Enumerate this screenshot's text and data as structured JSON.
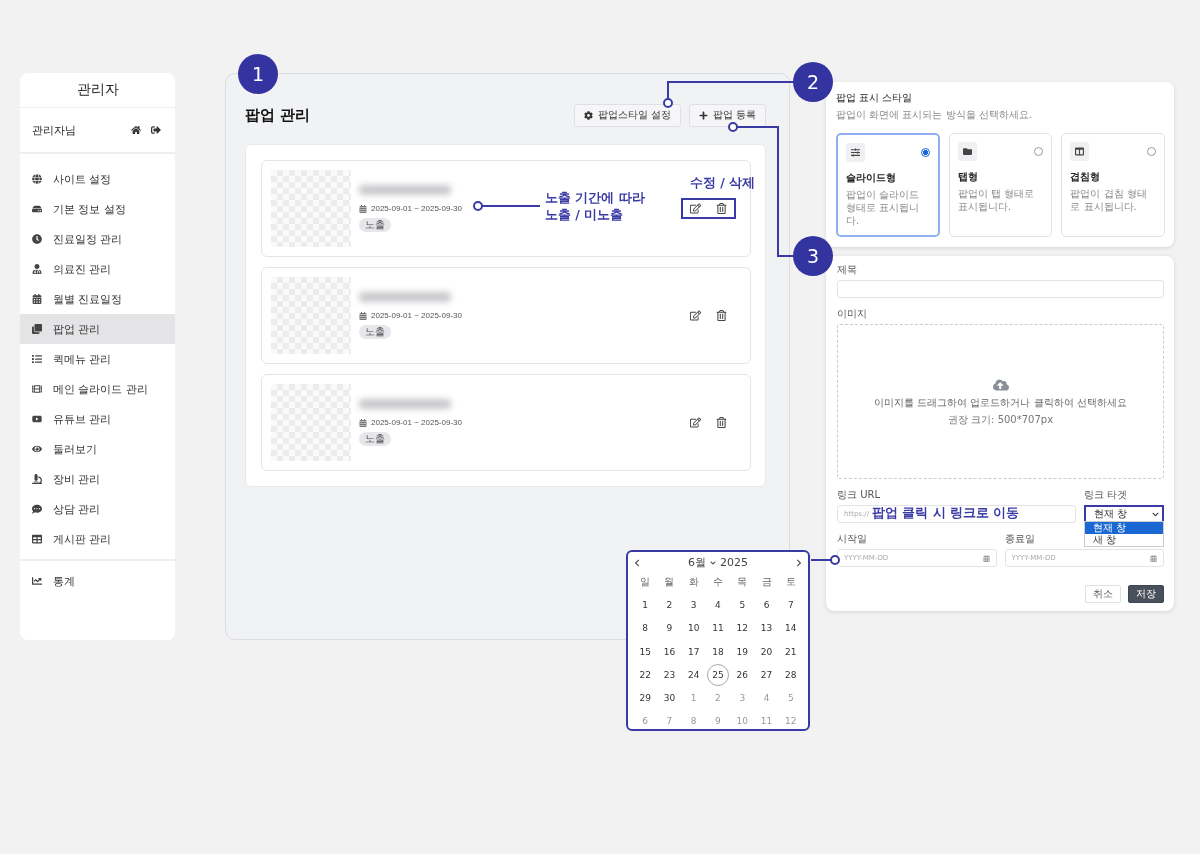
{
  "sidebar": {
    "title": "관리자",
    "user": "관리자님",
    "groups": [
      {
        "items": [
          {
            "label": "사이트 설정",
            "selected": false
          },
          {
            "label": "기본 정보 설정",
            "selected": false
          },
          {
            "label": "진료일정 관리",
            "selected": false
          },
          {
            "label": "의료진 관리",
            "selected": false
          },
          {
            "label": "월별 진료일정",
            "selected": false
          },
          {
            "label": "팝업 관리",
            "selected": true
          },
          {
            "label": "퀵메뉴 관리",
            "selected": false
          },
          {
            "label": "메인 슬라이드 관리",
            "selected": false
          },
          {
            "label": "유튜브 관리",
            "selected": false
          },
          {
            "label": "둘러보기",
            "selected": false
          },
          {
            "label": "장비 관리",
            "selected": false
          },
          {
            "label": "상담 관리",
            "selected": false
          },
          {
            "label": "게시판 관리",
            "selected": false
          }
        ]
      },
      {
        "items": [
          {
            "label": "통계",
            "selected": false
          }
        ]
      }
    ]
  },
  "main": {
    "badge": "1",
    "title": "팝업 관리",
    "buttons": [
      {
        "label": "팝업스타일 설정"
      },
      {
        "label": "팝업 등록"
      }
    ],
    "popups": [
      {
        "date_range": "2025-09-01 ~ 2025-09-30",
        "status": "노출",
        "highlighted": true
      },
      {
        "date_range": "2025-09-01 ~ 2025-09-30",
        "status": "노출",
        "highlighted": false
      },
      {
        "date_range": "2025-09-01 ~ 2025-09-30",
        "status": "노출",
        "highlighted": false
      }
    ]
  },
  "annotations": {
    "period": [
      "노출 기간에 따라",
      "노출 / 미노출"
    ],
    "actions": "수정 / 삭제",
    "link": "팝업 클릭 시 링크로 이동"
  },
  "style_panel": {
    "badge": "2",
    "title": "팝업 표시 스타일",
    "description": "팝업이 화면에 표시되는 방식을 선택하세요.",
    "options": [
      {
        "name": "슬라이드형",
        "description": "팝업이 슬라이드 형태로 표시됩니다.",
        "selected": true
      },
      {
        "name": "탭형",
        "description": "팝업이 탭 형태로 표시됩니다.",
        "selected": false
      },
      {
        "name": "겹침형",
        "description": "팝업이 겹침 형태로 표시됩니다.",
        "selected": false
      }
    ]
  },
  "form_panel": {
    "badge": "3",
    "title_label": "제목",
    "image_label": "이미지",
    "upload_text": "이미지를 드래그하여 업로드하거나 클릭하여 선택하세요",
    "upload_hint": "권장 크기: 500*707px",
    "link_url_label": "링크 URL",
    "link_url_placeholder": "https://",
    "link_target_label": "링크 타겟",
    "link_target_value": "현재 창",
    "link_target_options": [
      {
        "label": "현재 창",
        "selected": true
      },
      {
        "label": "새 창",
        "selected": false
      }
    ],
    "start_label": "시작일",
    "start_placeholder": "YYYY-MM-DD",
    "end_label": "종료일",
    "end_placeholder": "YYYY-MM-DD",
    "cancel": "취소",
    "save": "저장"
  },
  "calendar": {
    "month": "6월",
    "year": "2025",
    "weekdays": [
      "일",
      "월",
      "화",
      "수",
      "목",
      "금",
      "토"
    ],
    "days": [
      {
        "label": "1",
        "in_month": true,
        "selected": false
      },
      {
        "label": "2",
        "in_month": true,
        "selected": false
      },
      {
        "label": "3",
        "in_month": true,
        "selected": false
      },
      {
        "label": "4",
        "in_month": true,
        "selected": false
      },
      {
        "label": "5",
        "in_month": true,
        "selected": false
      },
      {
        "label": "6",
        "in_month": true,
        "selected": false
      },
      {
        "label": "7",
        "in_month": true,
        "selected": false
      },
      {
        "label": "8",
        "in_month": true,
        "selected": false
      },
      {
        "label": "9",
        "in_month": true,
        "selected": false
      },
      {
        "label": "10",
        "in_month": true,
        "selected": false
      },
      {
        "label": "11",
        "in_month": true,
        "selected": false
      },
      {
        "label": "12",
        "in_month": true,
        "selected": false
      },
      {
        "label": "13",
        "in_month": true,
        "selected": false
      },
      {
        "label": "14",
        "in_month": true,
        "selected": false
      },
      {
        "label": "15",
        "in_month": true,
        "selected": false
      },
      {
        "label": "16",
        "in_month": true,
        "selected": false
      },
      {
        "label": "17",
        "in_month": true,
        "selected": false
      },
      {
        "label": "18",
        "in_month": true,
        "selected": false
      },
      {
        "label": "19",
        "in_month": true,
        "selected": false
      },
      {
        "label": "20",
        "in_month": true,
        "selected": false
      },
      {
        "label": "21",
        "in_month": true,
        "selected": false
      },
      {
        "label": "22",
        "in_month": true,
        "selected": false
      },
      {
        "label": "23",
        "in_month": true,
        "selected": false
      },
      {
        "label": "24",
        "in_month": true,
        "selected": false
      },
      {
        "label": "25",
        "in_month": true,
        "selected": true
      },
      {
        "label": "26",
        "in_month": true,
        "selected": false
      },
      {
        "label": "27",
        "in_month": true,
        "selected": false
      },
      {
        "label": "28",
        "in_month": true,
        "selected": false
      },
      {
        "label": "29",
        "in_month": true,
        "selected": false
      },
      {
        "label": "30",
        "in_month": true,
        "selected": false
      },
      {
        "label": "1",
        "in_month": false,
        "selected": false
      },
      {
        "label": "2",
        "in_month": false,
        "selected": false
      },
      {
        "label": "3",
        "in_month": false,
        "selected": false
      },
      {
        "label": "4",
        "in_month": false,
        "selected": false
      },
      {
        "label": "5",
        "in_month": false,
        "selected": false
      },
      {
        "label": "6",
        "in_month": false,
        "selected": false
      },
      {
        "label": "7",
        "in_month": false,
        "selected": false
      },
      {
        "label": "8",
        "in_month": false,
        "selected": false
      },
      {
        "label": "9",
        "in_month": false,
        "selected": false
      },
      {
        "label": "10",
        "in_month": false,
        "selected": false
      },
      {
        "label": "11",
        "in_month": false,
        "selected": false
      },
      {
        "label": "12",
        "in_month": false,
        "selected": false
      }
    ]
  }
}
